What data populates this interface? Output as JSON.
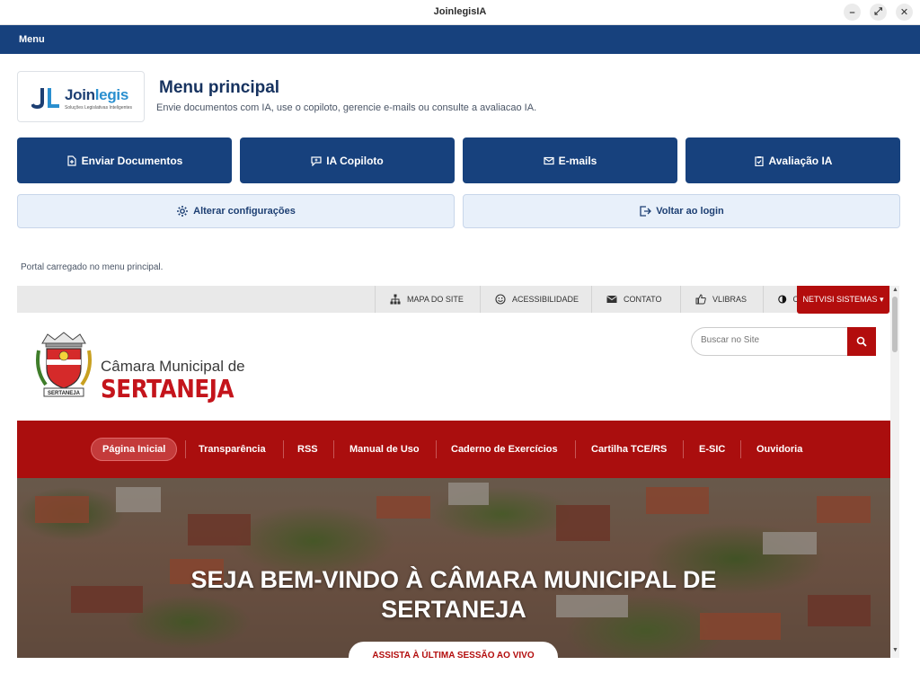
{
  "window": {
    "title": "JoinlegisIA"
  },
  "menubar": {
    "label": "Menu"
  },
  "header": {
    "logo_brand_join": "Join",
    "logo_brand_legis": "legis",
    "logo_tagline": "Soluções Legislativas Inteligentes",
    "title": "Menu principal",
    "subtitle": "Envie documentos com IA, use o copiloto, gerencie e-mails ou consulte a avaliacao IA."
  },
  "actions": {
    "enviar": "Enviar Documentos",
    "copiloto": "IA Copiloto",
    "emails": "E-mails",
    "avaliacao": "Avaliação IA",
    "configuracoes": "Alterar configurações",
    "voltar": "Voltar ao login"
  },
  "status": "Portal carregado no menu principal.",
  "site": {
    "top_links": {
      "mapa": "MAPA DO SITE",
      "acessibilidade": "ACESSIBILIDADE",
      "contato": "CONTATO",
      "vlibras": "VLIBRAS",
      "contraste": "C"
    },
    "netvisi": "NETVISI SISTEMAS ▾",
    "org_line1": "Câmara Municipal de",
    "org_line2": "SERTANEJA",
    "search_placeholder": "Buscar no Site",
    "nav": {
      "inicio": "Página Inicial",
      "transparencia": "Transparência",
      "rss": "RSS",
      "manual": "Manual de Uso",
      "caderno": "Caderno de Exercícios",
      "cartilha": "Cartilha TCE/RS",
      "esic": "E-SIC",
      "ouvidoria": "Ouvidoria"
    },
    "hero_title_line1": "SEJA BEM-VINDO À CÂMARA MUNICIPAL DE",
    "hero_title_line2": "SERTANEJA",
    "hero_button": "ASSISTA À ÚLTIMA SESSÃO AO VIVO"
  },
  "colors": {
    "primary": "#17417d",
    "site_red": "#aa0e0e",
    "secondary_bg": "#e8f0fa"
  }
}
